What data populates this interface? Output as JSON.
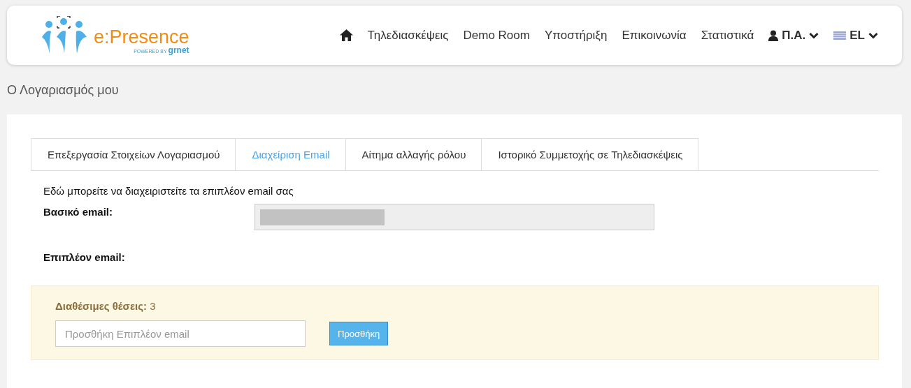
{
  "navbar": {
    "logo": {
      "name": "e:Presence",
      "tagline_small": "POWERED BY",
      "tagline": "grnet"
    },
    "items": [
      {
        "kind": "home"
      },
      {
        "kind": "link",
        "label": "Τηλεδιασκέψεις"
      },
      {
        "kind": "link",
        "label": "Demo Room"
      },
      {
        "kind": "link",
        "label": "Υποστήριξη"
      },
      {
        "kind": "link",
        "label": "Επικοινωνία"
      },
      {
        "kind": "link",
        "label": "Στατιστικά"
      },
      {
        "kind": "user",
        "label": "Π.Α."
      },
      {
        "kind": "language",
        "label": "EL"
      }
    ]
  },
  "page_title": "Ο Λογαριασμός μου",
  "tabs": [
    {
      "label": "Επεξεργασία Στοιχείων Λογαριασμού",
      "selected": false
    },
    {
      "label": "Διαχείριση Email",
      "selected": true
    },
    {
      "label": "Αίτημα αλλαγής ρόλου",
      "selected": false
    },
    {
      "label": "Ιστορικό Συμμετοχής σε Τηλεδιασκέψεις",
      "selected": false
    }
  ],
  "intro": "Εδώ μπορείτε να διαχειριστείτε τα επιπλέον email σας",
  "primary_email": {
    "label": "Βασικό email:",
    "redacted": true,
    "disabled": true
  },
  "extra_email": {
    "label": "Επιπλέον email:"
  },
  "slots": {
    "label": "Διαθέσιμες θέσεις:",
    "value": "3"
  },
  "add_field": {
    "placeholder": "Προσθήκη Επιπλέον email"
  },
  "add_button": "Προσθήκη"
}
